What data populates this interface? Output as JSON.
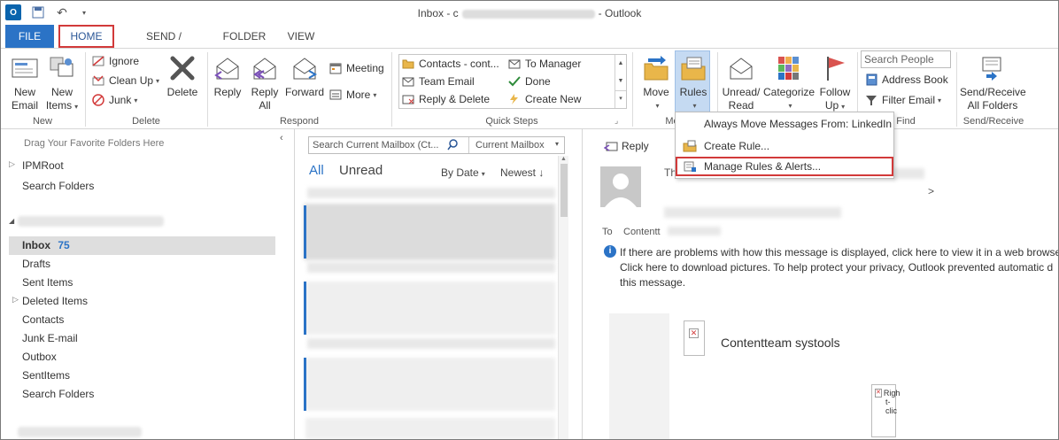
{
  "window": {
    "title_prefix": "Inbox - c",
    "title_suffix": "- Outlook",
    "app_logo": "O"
  },
  "tabs": [
    "FILE",
    "HOME",
    "SEND / RECEIVE",
    "FOLDER",
    "VIEW"
  ],
  "ribbon": {
    "groups": {
      "new": "New",
      "delete": "Delete",
      "respond": "Respond",
      "quick_steps": "Quick Steps",
      "move": "Mo",
      "find": "Find",
      "send_receive": "Send/Receive"
    },
    "new_email": [
      "New",
      "Email"
    ],
    "new_items": [
      "New",
      "Items"
    ],
    "ignore": "Ignore",
    "clean_up": "Clean Up",
    "junk": "Junk",
    "delete": "Delete",
    "reply": "Reply",
    "reply_all": [
      "Reply",
      "All"
    ],
    "forward": "Forward",
    "meeting": "Meeting",
    "more": "More",
    "quick_steps": {
      "contacts": "Contacts - cont...",
      "to_manager": "To Manager",
      "team_email": "Team Email",
      "done": "Done",
      "reply_delete": "Reply & Delete",
      "create_new": "Create New"
    },
    "move": "Move",
    "rules": "Rules",
    "unread_read": [
      "Unread/",
      "Read"
    ],
    "categorize": "Categorize",
    "follow_up": [
      "Follow",
      "Up"
    ],
    "search_people": "Search People",
    "address_book": "Address Book",
    "filter_email": "Filter Email",
    "send_receive_all": [
      "Send/Receive",
      "All Folders"
    ]
  },
  "rules_menu": {
    "always_move": "Always Move Messages From: LinkedIn",
    "create_rule": "Create Rule...",
    "manage_rules": "Manage Rules & Alerts..."
  },
  "nav": {
    "drag_hint": "Drag Your Favorite Folders Here",
    "ipm_root": "IPMRoot",
    "search_folders_top": "Search Folders",
    "inbox": "Inbox",
    "inbox_count": "75",
    "folders": [
      "Drafts",
      "Sent Items",
      "Deleted Items",
      "Contacts",
      "Junk E-mail",
      "Outbox",
      "SentItems",
      "Search Folders"
    ]
  },
  "message_list": {
    "search_placeholder": "Search Current Mailbox (Ct...",
    "scope": "Current Mailbox",
    "filter_all": "All",
    "filter_unread": "Unread",
    "sort_by": "By Date",
    "sort_order": "Newest"
  },
  "reading": {
    "reply": "Reply",
    "to_label": "To",
    "to_value": "Contentt",
    "info_lines": [
      "If there are problems with how this message is displayed, click here to view it in a web browser",
      "Click here to download pictures. To help protect your privacy, Outlook prevented automatic d",
      "this message."
    ],
    "from_prefix": "Th",
    "body_heading": "Contentteam systools",
    "image_alt": [
      "Righ",
      "t-",
      "clic"
    ]
  },
  "colors": {
    "accent": "#2b73c6",
    "highlight_red": "#d23a3a",
    "selection": "#c5daf2"
  }
}
